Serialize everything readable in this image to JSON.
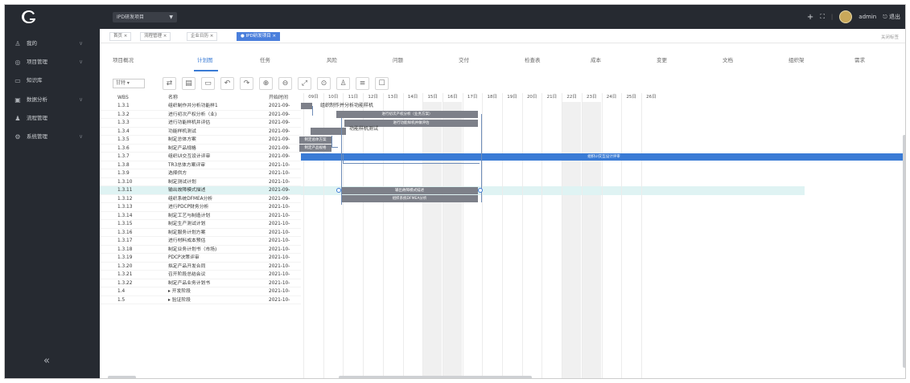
{
  "header": {
    "project_select": "IPD研发项目",
    "caret": "▼",
    "icons": [
      "plus-icon",
      "fullscreen-icon"
    ],
    "user_name": "admin",
    "logout_label": "退出"
  },
  "sidebar": {
    "items": [
      {
        "label": "我的",
        "icon": "user-icon",
        "arrow": "∨"
      },
      {
        "label": "项目管理",
        "icon": "project-icon",
        "arrow": "∨"
      },
      {
        "label": "知识库",
        "icon": "folder-icon",
        "arrow": ""
      },
      {
        "label": "数据分析",
        "icon": "chart-icon",
        "arrow": "∨"
      },
      {
        "label": "流程管理",
        "icon": "person-icon",
        "arrow": ""
      },
      {
        "label": "系统管理",
        "icon": "settings-icon",
        "arrow": "∨"
      }
    ],
    "collapse": "«"
  },
  "tabs": [
    {
      "label": "首页 ×",
      "active": false
    },
    {
      "label": "流程管理 ×",
      "active": false
    },
    {
      "label": "企业日历 ×",
      "active": false
    },
    {
      "label": "● IPD研发项目 ×",
      "active": true
    }
  ],
  "tabs_close_all": "关闭标签",
  "subnav": [
    "项目概况",
    "计划图",
    "任务",
    "风险",
    "问题",
    "交付",
    "检查表",
    "成本",
    "变更",
    "文档",
    "组织架",
    "需求"
  ],
  "subnav_active_index": 1,
  "toolbar": {
    "view_select": "甘特 ▾",
    "buttons": [
      "⇄",
      "▤",
      "▭",
      "↶",
      "↷",
      "⊕",
      "⊖",
      "⤢",
      "⊙",
      "♙",
      "≡",
      "☐"
    ]
  },
  "table": {
    "headers": {
      "wbs": "WBS",
      "name": "名称",
      "start": "开始时间"
    },
    "rows": [
      {
        "wbs": "1.3.1",
        "name": "组织制作并分析功能样1",
        "start": "2021-09-"
      },
      {
        "wbs": "1.3.2",
        "name": "进行初次产权分析（业)",
        "start": "2021-09-"
      },
      {
        "wbs": "1.3.3",
        "name": "进行功能样机并评估",
        "start": "2021-09-"
      },
      {
        "wbs": "1.3.4",
        "name": "功能样机测试",
        "start": "2021-09-"
      },
      {
        "wbs": "1.3.5",
        "name": "制定总体方案",
        "start": "2021-09-"
      },
      {
        "wbs": "1.3.6",
        "name": "制定产品规格",
        "start": "2021-09-"
      },
      {
        "wbs": "1.3.7",
        "name": "组织UI交互设计评审",
        "start": "2021-09-"
      },
      {
        "wbs": "1.3.8",
        "name": "TR3总体方案评审",
        "start": "2021-10-"
      },
      {
        "wbs": "1.3.9",
        "name": "选择供方",
        "start": "2021-10-"
      },
      {
        "wbs": "1.3.10",
        "name": "制定测试计划",
        "start": "2021-10-"
      },
      {
        "wbs": "1.3.11",
        "name": "输出故障模式描述",
        "start": "2021-09-"
      },
      {
        "wbs": "1.3.12",
        "name": "组织系统DFMEA分析",
        "start": "2021-09-"
      },
      {
        "wbs": "1.3.13",
        "name": "进行PDCP财务分析",
        "start": "2021-10-"
      },
      {
        "wbs": "1.3.14",
        "name": "制定工艺与制造计划",
        "start": "2021-10-"
      },
      {
        "wbs": "1.3.15",
        "name": "制定生产测试计划",
        "start": "2021-10-"
      },
      {
        "wbs": "1.3.16",
        "name": "制定服务计划方案",
        "start": "2021-10-"
      },
      {
        "wbs": "1.3.17",
        "name": "进行材料成本预估",
        "start": "2021-10-"
      },
      {
        "wbs": "1.3.18",
        "name": "制定业务计划书（市场)",
        "start": "2021-10-"
      },
      {
        "wbs": "1.3.19",
        "name": "PDCP决策评审",
        "start": "2021-10-"
      },
      {
        "wbs": "1.3.20",
        "name": "拟定产品开发合同",
        "start": "2021-10-"
      },
      {
        "wbs": "1.3.21",
        "name": "召开阶段总结会议",
        "start": "2021-10-"
      },
      {
        "wbs": "1.3.22",
        "name": "制定产品业务计划书",
        "start": "2021-10-"
      },
      {
        "wbs": "1.4",
        "name": "▸ 开发阶段",
        "start": "2021-10-"
      },
      {
        "wbs": "1.5",
        "name": "▸ 验证阶段",
        "start": "2021-10-"
      }
    ],
    "highlight_index": 10
  },
  "gantt": {
    "dates": [
      "09日",
      "10日",
      "11日",
      "12日",
      "13日",
      "14日",
      "15日",
      "16日",
      "17日",
      "18日",
      "19日",
      "20日",
      "21日",
      "22日",
      "23日",
      "24日",
      "25日",
      "26日"
    ],
    "weekend_indices": [
      6,
      7,
      13,
      14
    ],
    "top_label": "组织制作并分析功能样机",
    "bars": [
      {
        "label": "进行初次产权分析（业务方案）",
        "color": "#7d8089"
      },
      {
        "label": "进行功能样机并做评估",
        "color": "#7d8089"
      },
      {
        "label": "功能样机测试",
        "color": "#7d8089"
      },
      {
        "label": "制定总体方案",
        "color": "#7d8089"
      },
      {
        "label": "制定产品规格",
        "color": "#7d8089"
      },
      {
        "label": "组织UI交互设计评审",
        "color": "#3a7bd5"
      },
      {
        "label": "输出故障模式描述",
        "color": "#7d8089"
      },
      {
        "label": "组织系统DFMEA分析",
        "color": "#7d8089"
      }
    ]
  }
}
